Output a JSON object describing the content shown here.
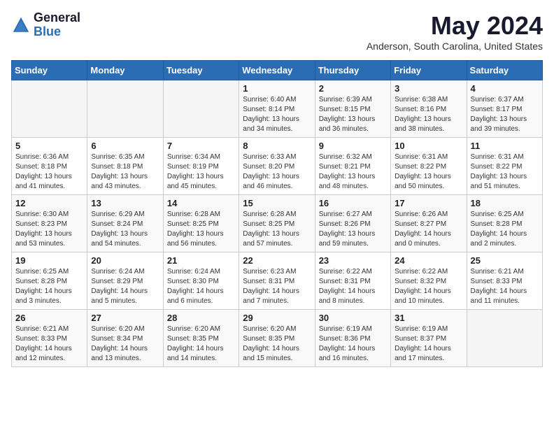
{
  "logo": {
    "general": "General",
    "blue": "Blue"
  },
  "title": "May 2024",
  "location": "Anderson, South Carolina, United States",
  "days_of_week": [
    "Sunday",
    "Monday",
    "Tuesday",
    "Wednesday",
    "Thursday",
    "Friday",
    "Saturday"
  ],
  "weeks": [
    [
      {
        "day": "",
        "info": ""
      },
      {
        "day": "",
        "info": ""
      },
      {
        "day": "",
        "info": ""
      },
      {
        "day": "1",
        "info": "Sunrise: 6:40 AM\nSunset: 8:14 PM\nDaylight: 13 hours and 34 minutes."
      },
      {
        "day": "2",
        "info": "Sunrise: 6:39 AM\nSunset: 8:15 PM\nDaylight: 13 hours and 36 minutes."
      },
      {
        "day": "3",
        "info": "Sunrise: 6:38 AM\nSunset: 8:16 PM\nDaylight: 13 hours and 38 minutes."
      },
      {
        "day": "4",
        "info": "Sunrise: 6:37 AM\nSunset: 8:17 PM\nDaylight: 13 hours and 39 minutes."
      }
    ],
    [
      {
        "day": "5",
        "info": "Sunrise: 6:36 AM\nSunset: 8:18 PM\nDaylight: 13 hours and 41 minutes."
      },
      {
        "day": "6",
        "info": "Sunrise: 6:35 AM\nSunset: 8:18 PM\nDaylight: 13 hours and 43 minutes."
      },
      {
        "day": "7",
        "info": "Sunrise: 6:34 AM\nSunset: 8:19 PM\nDaylight: 13 hours and 45 minutes."
      },
      {
        "day": "8",
        "info": "Sunrise: 6:33 AM\nSunset: 8:20 PM\nDaylight: 13 hours and 46 minutes."
      },
      {
        "day": "9",
        "info": "Sunrise: 6:32 AM\nSunset: 8:21 PM\nDaylight: 13 hours and 48 minutes."
      },
      {
        "day": "10",
        "info": "Sunrise: 6:31 AM\nSunset: 8:22 PM\nDaylight: 13 hours and 50 minutes."
      },
      {
        "day": "11",
        "info": "Sunrise: 6:31 AM\nSunset: 8:22 PM\nDaylight: 13 hours and 51 minutes."
      }
    ],
    [
      {
        "day": "12",
        "info": "Sunrise: 6:30 AM\nSunset: 8:23 PM\nDaylight: 13 hours and 53 minutes."
      },
      {
        "day": "13",
        "info": "Sunrise: 6:29 AM\nSunset: 8:24 PM\nDaylight: 13 hours and 54 minutes."
      },
      {
        "day": "14",
        "info": "Sunrise: 6:28 AM\nSunset: 8:25 PM\nDaylight: 13 hours and 56 minutes."
      },
      {
        "day": "15",
        "info": "Sunrise: 6:28 AM\nSunset: 8:25 PM\nDaylight: 13 hours and 57 minutes."
      },
      {
        "day": "16",
        "info": "Sunrise: 6:27 AM\nSunset: 8:26 PM\nDaylight: 13 hours and 59 minutes."
      },
      {
        "day": "17",
        "info": "Sunrise: 6:26 AM\nSunset: 8:27 PM\nDaylight: 14 hours and 0 minutes."
      },
      {
        "day": "18",
        "info": "Sunrise: 6:25 AM\nSunset: 8:28 PM\nDaylight: 14 hours and 2 minutes."
      }
    ],
    [
      {
        "day": "19",
        "info": "Sunrise: 6:25 AM\nSunset: 8:28 PM\nDaylight: 14 hours and 3 minutes."
      },
      {
        "day": "20",
        "info": "Sunrise: 6:24 AM\nSunset: 8:29 PM\nDaylight: 14 hours and 5 minutes."
      },
      {
        "day": "21",
        "info": "Sunrise: 6:24 AM\nSunset: 8:30 PM\nDaylight: 14 hours and 6 minutes."
      },
      {
        "day": "22",
        "info": "Sunrise: 6:23 AM\nSunset: 8:31 PM\nDaylight: 14 hours and 7 minutes."
      },
      {
        "day": "23",
        "info": "Sunrise: 6:22 AM\nSunset: 8:31 PM\nDaylight: 14 hours and 8 minutes."
      },
      {
        "day": "24",
        "info": "Sunrise: 6:22 AM\nSunset: 8:32 PM\nDaylight: 14 hours and 10 minutes."
      },
      {
        "day": "25",
        "info": "Sunrise: 6:21 AM\nSunset: 8:33 PM\nDaylight: 14 hours and 11 minutes."
      }
    ],
    [
      {
        "day": "26",
        "info": "Sunrise: 6:21 AM\nSunset: 8:33 PM\nDaylight: 14 hours and 12 minutes."
      },
      {
        "day": "27",
        "info": "Sunrise: 6:20 AM\nSunset: 8:34 PM\nDaylight: 14 hours and 13 minutes."
      },
      {
        "day": "28",
        "info": "Sunrise: 6:20 AM\nSunset: 8:35 PM\nDaylight: 14 hours and 14 minutes."
      },
      {
        "day": "29",
        "info": "Sunrise: 6:20 AM\nSunset: 8:35 PM\nDaylight: 14 hours and 15 minutes."
      },
      {
        "day": "30",
        "info": "Sunrise: 6:19 AM\nSunset: 8:36 PM\nDaylight: 14 hours and 16 minutes."
      },
      {
        "day": "31",
        "info": "Sunrise: 6:19 AM\nSunset: 8:37 PM\nDaylight: 14 hours and 17 minutes."
      },
      {
        "day": "",
        "info": ""
      }
    ]
  ]
}
